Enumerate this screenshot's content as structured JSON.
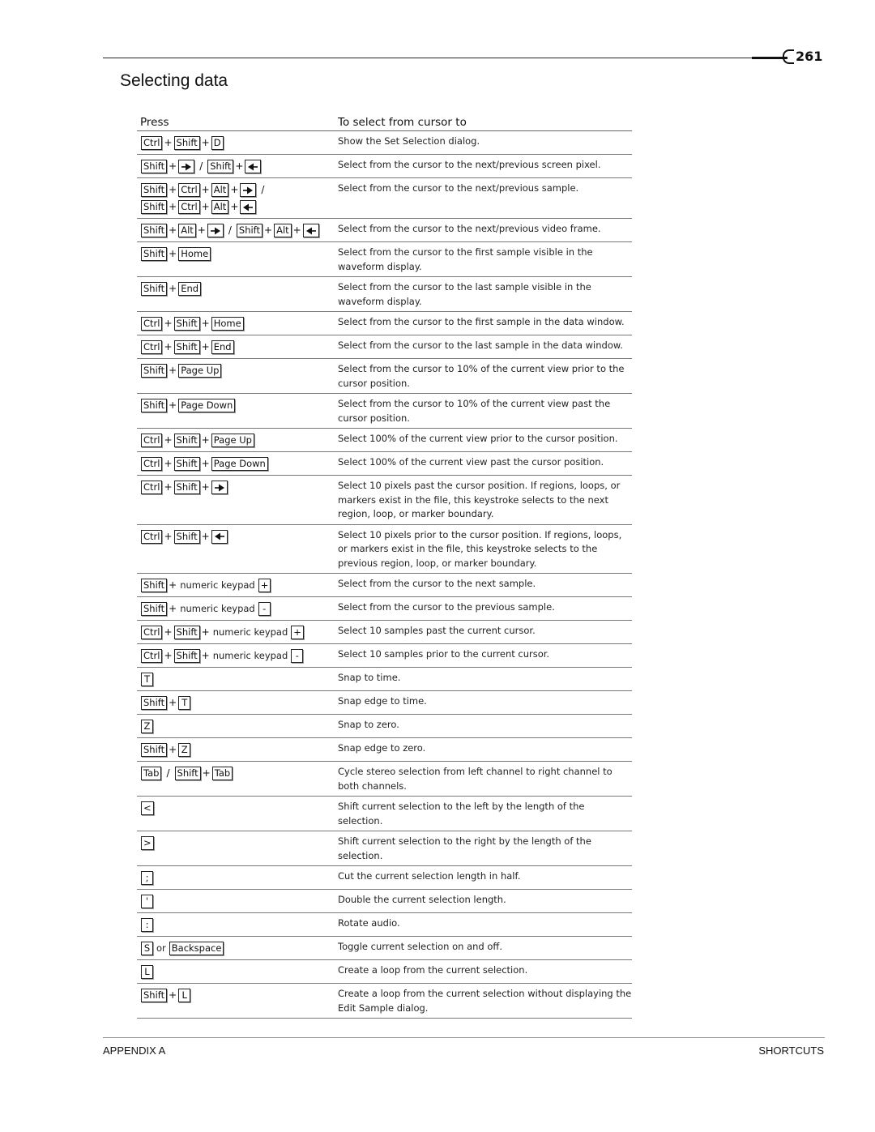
{
  "header": {
    "page_number": "261",
    "title": "Selecting data"
  },
  "table": {
    "columns": [
      "Press",
      "To select from cursor to"
    ],
    "rows": [
      {
        "keys": [
          [
            {
              "k": "Ctrl"
            },
            {
              "s": "+"
            },
            {
              "k": "Shift"
            },
            {
              "s": "+"
            },
            {
              "k": "D"
            }
          ]
        ],
        "desc": "Show the Set Selection dialog."
      },
      {
        "keys": [
          [
            {
              "k": "Shift"
            },
            {
              "s": "+"
            },
            {
              "a": "right-arrow"
            },
            {
              "sl": "/"
            },
            {
              "k": "Shift"
            },
            {
              "s": "+"
            },
            {
              "a": "left-arrow"
            }
          ]
        ],
        "desc": "Select from the cursor to the next/previous screen pixel."
      },
      {
        "keys": [
          [
            {
              "k": "Shift"
            },
            {
              "s": "+"
            },
            {
              "k": "Ctrl"
            },
            {
              "s": "+"
            },
            {
              "k": "Alt"
            },
            {
              "s": "+"
            },
            {
              "a": "right-arrow"
            },
            {
              "sl": "/"
            }
          ],
          [
            {
              "k": "Shift"
            },
            {
              "s": "+"
            },
            {
              "k": "Ctrl"
            },
            {
              "s": "+"
            },
            {
              "k": "Alt"
            },
            {
              "s": "+"
            },
            {
              "a": "left-arrow"
            }
          ]
        ],
        "desc": "Select from the cursor to the next/previous sample."
      },
      {
        "keys": [
          [
            {
              "k": "Shift"
            },
            {
              "s": "+"
            },
            {
              "k": "Alt"
            },
            {
              "s": "+"
            },
            {
              "a": "right-arrow"
            },
            {
              "sl": "/"
            },
            {
              "k": "Shift"
            },
            {
              "s": "+"
            },
            {
              "k": "Alt"
            },
            {
              "s": "+"
            },
            {
              "a": "left-arrow"
            }
          ]
        ],
        "desc": "Select from the cursor to the next/previous video frame."
      },
      {
        "keys": [
          [
            {
              "k": "Shift"
            },
            {
              "s": "+"
            },
            {
              "k": "Home"
            }
          ]
        ],
        "desc": "Select from the cursor to the first sample visible in the waveform display."
      },
      {
        "keys": [
          [
            {
              "k": "Shift"
            },
            {
              "s": "+"
            },
            {
              "k": "End"
            }
          ]
        ],
        "desc": "Select from the cursor to the last sample visible in the waveform display."
      },
      {
        "keys": [
          [
            {
              "k": "Ctrl"
            },
            {
              "s": "+"
            },
            {
              "k": "Shift"
            },
            {
              "s": "+"
            },
            {
              "k": "Home"
            }
          ]
        ],
        "desc": "Select from the cursor to the first sample in the data window."
      },
      {
        "keys": [
          [
            {
              "k": "Ctrl"
            },
            {
              "s": "+"
            },
            {
              "k": "Shift"
            },
            {
              "s": "+"
            },
            {
              "k": "End"
            }
          ]
        ],
        "desc": "Select from the cursor to the last sample in the data window."
      },
      {
        "keys": [
          [
            {
              "k": "Shift"
            },
            {
              "s": "+"
            },
            {
              "k": "Page Up"
            }
          ]
        ],
        "desc": "Select from the cursor to 10% of the current view prior to the cursor position."
      },
      {
        "keys": [
          [
            {
              "k": "Shift"
            },
            {
              "s": "+"
            },
            {
              "k": "Page Down"
            }
          ]
        ],
        "desc": "Select from the cursor to 10% of the current view past the cursor position."
      },
      {
        "keys": [
          [
            {
              "k": "Ctrl"
            },
            {
              "s": "+"
            },
            {
              "k": "Shift"
            },
            {
              "s": "+"
            },
            {
              "k": "Page Up"
            }
          ]
        ],
        "desc": "Select 100% of the current view prior to the cursor position."
      },
      {
        "keys": [
          [
            {
              "k": "Ctrl"
            },
            {
              "s": "+"
            },
            {
              "k": "Shift"
            },
            {
              "s": "+"
            },
            {
              "k": "Page Down"
            }
          ]
        ],
        "desc": "Select 100% of the current view past the cursor position."
      },
      {
        "keys": [
          [
            {
              "k": "Ctrl"
            },
            {
              "s": "+"
            },
            {
              "k": "Shift"
            },
            {
              "s": "+"
            },
            {
              "a": "right-arrow"
            }
          ]
        ],
        "desc": "Select 10 pixels past the cursor position. If regions, loops, or markers exist in the file, this keystroke selects to the next region, loop, or marker boundary."
      },
      {
        "keys": [
          [
            {
              "k": "Ctrl"
            },
            {
              "s": "+"
            },
            {
              "k": "Shift"
            },
            {
              "s": "+"
            },
            {
              "a": "left-arrow"
            }
          ]
        ],
        "desc": "Select 10 pixels prior to the cursor position. If regions, loops, or markers exist in the file, this keystroke selects to the previous region, loop, or marker boundary."
      },
      {
        "keys": [
          [
            {
              "k": "Shift"
            },
            {
              "s": "+"
            },
            {
              "t": "numeric keypad"
            },
            {
              "k": "+"
            }
          ]
        ],
        "desc": "Select from the cursor to the next sample."
      },
      {
        "keys": [
          [
            {
              "k": "Shift"
            },
            {
              "s": "+"
            },
            {
              "t": "numeric keypad"
            },
            {
              "k": "-"
            }
          ]
        ],
        "desc": "Select from the cursor to the previous sample."
      },
      {
        "keys": [
          [
            {
              "k": "Ctrl"
            },
            {
              "s": "+"
            },
            {
              "k": "Shift"
            },
            {
              "s": "+"
            },
            {
              "t": "numeric keypad"
            },
            {
              "k": "+"
            }
          ]
        ],
        "desc": "Select 10 samples past the current cursor."
      },
      {
        "keys": [
          [
            {
              "k": "Ctrl"
            },
            {
              "s": "+"
            },
            {
              "k": "Shift"
            },
            {
              "s": "+"
            },
            {
              "t": "numeric keypad"
            },
            {
              "k": "-"
            }
          ]
        ],
        "desc": "Select 10 samples prior to the current cursor."
      },
      {
        "keys": [
          [
            {
              "k": "T"
            }
          ]
        ],
        "desc": "Snap to time."
      },
      {
        "keys": [
          [
            {
              "k": "Shift"
            },
            {
              "s": "+"
            },
            {
              "k": "T"
            }
          ]
        ],
        "desc": "Snap edge to time."
      },
      {
        "keys": [
          [
            {
              "k": "Z"
            }
          ]
        ],
        "desc": "Snap to zero."
      },
      {
        "keys": [
          [
            {
              "k": "Shift"
            },
            {
              "s": "+"
            },
            {
              "k": "Z"
            }
          ]
        ],
        "desc": "Snap edge to zero."
      },
      {
        "keys": [
          [
            {
              "k": "Tab"
            },
            {
              "sl": "/"
            },
            {
              "k": "Shift"
            },
            {
              "s": "+"
            },
            {
              "k": "Tab"
            }
          ]
        ],
        "desc": "Cycle stereo selection from left channel to right channel to both channels."
      },
      {
        "keys": [
          [
            {
              "k": "<"
            }
          ]
        ],
        "desc": "Shift current selection to the left by the length of the selection."
      },
      {
        "keys": [
          [
            {
              "k": ">"
            }
          ]
        ],
        "desc": "Shift current selection to the right by the length of the selection."
      },
      {
        "keys": [
          [
            {
              "k": ";"
            }
          ]
        ],
        "desc": "Cut the current selection length in half."
      },
      {
        "keys": [
          [
            {
              "k": "'"
            }
          ]
        ],
        "desc": "Double the current selection length."
      },
      {
        "keys": [
          [
            {
              "k": ":"
            }
          ]
        ],
        "desc": "Rotate audio."
      },
      {
        "keys": [
          [
            {
              "k": "S"
            },
            {
              "t": "or"
            },
            {
              "k": "Backspace"
            }
          ]
        ],
        "desc": "Toggle current selection on and off."
      },
      {
        "keys": [
          [
            {
              "k": "L"
            }
          ]
        ],
        "desc": "Create a loop from the current selection."
      },
      {
        "keys": [
          [
            {
              "k": "Shift"
            },
            {
              "s": "+"
            },
            {
              "k": "L"
            }
          ]
        ],
        "desc": "Create a loop from the current selection without displaying the Edit Sample dialog."
      }
    ]
  },
  "footer": {
    "left": "APPENDIX A",
    "right": "SHORTCUTS"
  }
}
